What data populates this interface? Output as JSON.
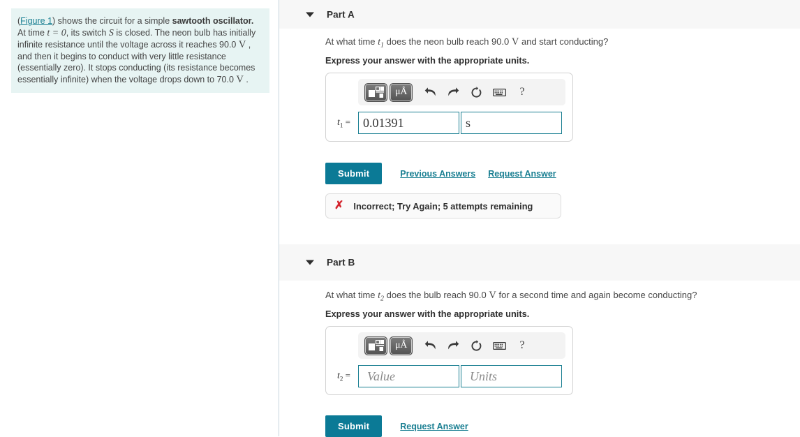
{
  "problem": {
    "figure_link": "Figure 1",
    "text_before": "(",
    "text_1": ") shows the circuit for a simple ",
    "bold_1": "sawtooth oscillator.",
    "text_2": " At time ",
    "math_t0": "t = 0",
    "text_3": ", its switch ",
    "math_S": "S",
    "text_4": " is closed. The neon bulb has initially infinite resistance until the voltage across it reaches 90.0 ",
    "math_V1": "V",
    "text_5": " , and then it begins to conduct with very little resistance (essentially zero). It stops conducting (its resistance becomes essentially infinite) when the voltage drops down to 70.0 ",
    "math_V2": "V",
    "text_6": " ."
  },
  "parts": [
    {
      "title": "Part A",
      "caret": "chevron-down-icon",
      "question_pre": "At what time ",
      "question_var": "t",
      "question_sub": "1",
      "question_mid": " does the neon bulb reach 90.0 ",
      "question_unit": "V",
      "question_post": " and start conducting?",
      "instruction": "Express your answer with the appropriate units.",
      "toolbar": {
        "template_button": "template-icon",
        "units_button": "μÅ",
        "undo": "undo-icon",
        "redo": "redo-icon",
        "reset": "reset-icon",
        "keyboard": "keyboard-icon",
        "help": "?"
      },
      "field": {
        "label_var": "t",
        "label_sub": "1",
        "label_eq": "=",
        "value": "0.01391",
        "value_placeholder": "Value",
        "units": "s",
        "units_placeholder": "Units"
      },
      "submit_label": "Submit",
      "links": [
        "Previous Answers",
        "Request Answer"
      ],
      "feedback": {
        "icon": "x-mark-icon",
        "text": "Incorrect; Try Again; 5 attempts remaining",
        "color": "#d4232c"
      }
    },
    {
      "title": "Part B",
      "caret": "chevron-down-icon",
      "question_pre": "At what time ",
      "question_var": "t",
      "question_sub": "2",
      "question_mid": " does the bulb reach 90.0 ",
      "question_unit": "V",
      "question_post": " for a second time and again become conducting?",
      "instruction": "Express your answer with the appropriate units.",
      "toolbar": {
        "template_button": "template-icon",
        "units_button": "μÅ",
        "undo": "undo-icon",
        "redo": "redo-icon",
        "reset": "reset-icon",
        "keyboard": "keyboard-icon",
        "help": "?"
      },
      "field": {
        "label_var": "t",
        "label_sub": "2",
        "label_eq": "=",
        "value": "",
        "value_placeholder": "Value",
        "units": "",
        "units_placeholder": "Units"
      },
      "submit_label": "Submit",
      "links": [
        "Request Answer"
      ],
      "feedback": null
    }
  ],
  "colors": {
    "accent": "#0b7a96",
    "link": "#1a7f92",
    "panel": "#e7f4f3",
    "header_band": "#f7f7f7",
    "error": "#d4232c",
    "field_border": "#1a7f92"
  }
}
